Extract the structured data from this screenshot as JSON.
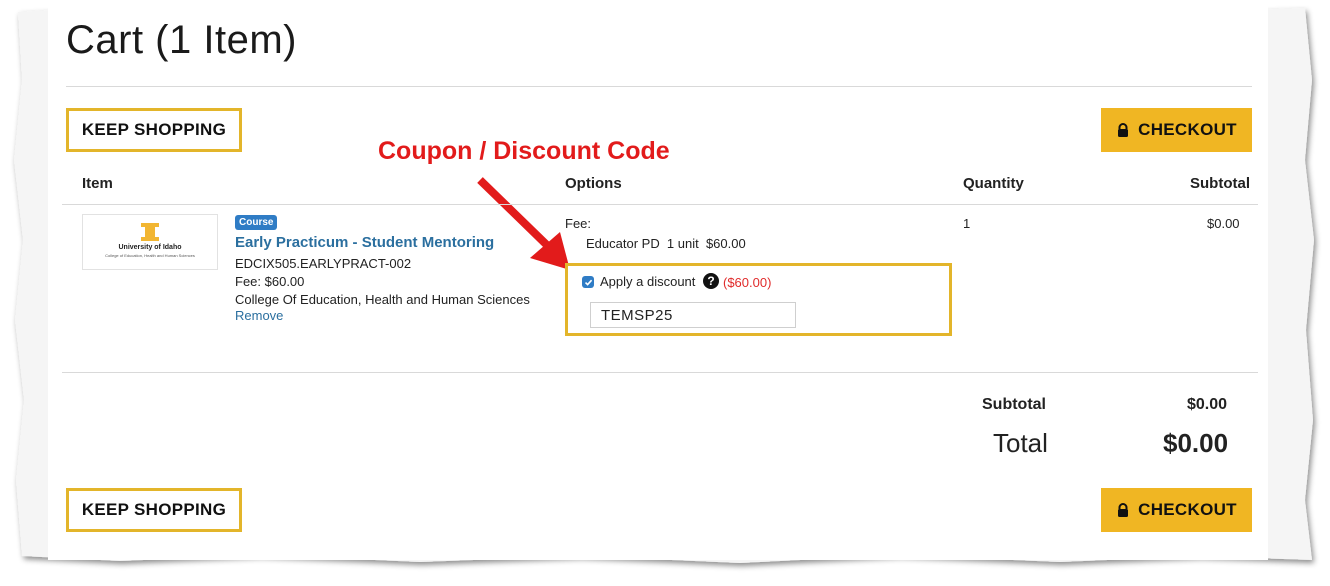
{
  "cart": {
    "title": "Cart (1 Item)",
    "keep_shopping_label": "KEEP SHOPPING",
    "checkout_label": "CHECKOUT"
  },
  "annotation": "Coupon / Discount Code",
  "table": {
    "headers": [
      "Item",
      "Options",
      "Quantity",
      "Subtotal"
    ]
  },
  "item": {
    "logo_text": "University of Idaho",
    "logo_subtext": "College of Education, Health and Human Sciences",
    "badge": "Course",
    "title": "Early Practicum - Student Mentoring",
    "code": "EDCIX505.EARLYPRACT-002",
    "fee": "Fee: $60.00",
    "college": "College Of Education, Health and Human Sciences",
    "remove": "Remove",
    "quantity": "1",
    "subtotal": "$0.00"
  },
  "options": {
    "fee_label": "Fee:",
    "fee_line": "Educator PD  1 unit  $60.00",
    "discount_label": "Apply a discount",
    "discount_checked": true,
    "discount_amount": "($60.00)",
    "discount_code": "TEMSP25"
  },
  "summary": {
    "subtotal_label": "Subtotal",
    "subtotal_value": "$0.00",
    "total_label": "Total",
    "total_value": "$0.00"
  },
  "colors": {
    "accent_gold": "#f0b623",
    "border_gold": "#e3b52a",
    "link_blue": "#2b6f9f",
    "annotation_red": "#e21b1b"
  }
}
